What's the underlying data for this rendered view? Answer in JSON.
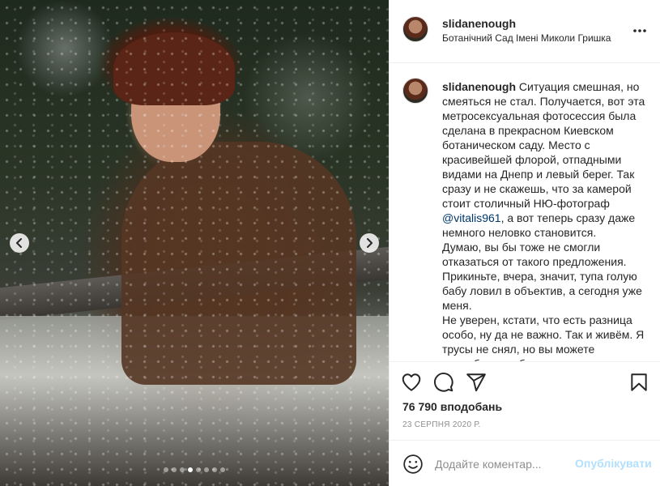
{
  "post": {
    "username": "slidanenough",
    "location": "Ботанічний Сад Імені Миколи Гришка",
    "caption_user": "slidanenough",
    "caption_part1": " Ситуация смешная, но смеяться не стал. Получается, вот эта метросексуальная фотосессия была сделана в прекрасном Киевском ботаническом саду. Место с красивейшей флорой, отпадными видами на Днепр и левый берег. Так сразу и не скажешь, что за камерой стоит столичный НЮ-фотограф ",
    "caption_mention": "@vitalis961",
    "caption_part2": ", а вот теперь сразу даже немного неловко становится.\nДумаю, вы бы тоже не смогли отказаться от такого предложения. Прикиньте, вчера, значит, тупа голую бабу ловил в объектив, а сегодня уже меня.\nНе уверен, кстати, что есть разница особо, ну да не важно. Так и живём. Я трусы не снял, но вы можете попробовать обратиться с таким",
    "likes": "76 790 вподобань",
    "date": "23 СЕРПНЯ 2020 Р."
  },
  "carousel": {
    "slide_count": 8,
    "active_index": 3
  },
  "comment_box": {
    "placeholder": "Додайте коментар...",
    "publish_label": "Опублікувати"
  },
  "colors": {
    "accent_disabled": "#b2dffc",
    "mention": "#00376b",
    "muted": "#8e8e8e"
  },
  "icons": [
    "chevron-left-icon",
    "chevron-right-icon",
    "more-icon",
    "heart-icon",
    "comment-icon",
    "share-icon",
    "bookmark-icon",
    "emoji-icon"
  ]
}
